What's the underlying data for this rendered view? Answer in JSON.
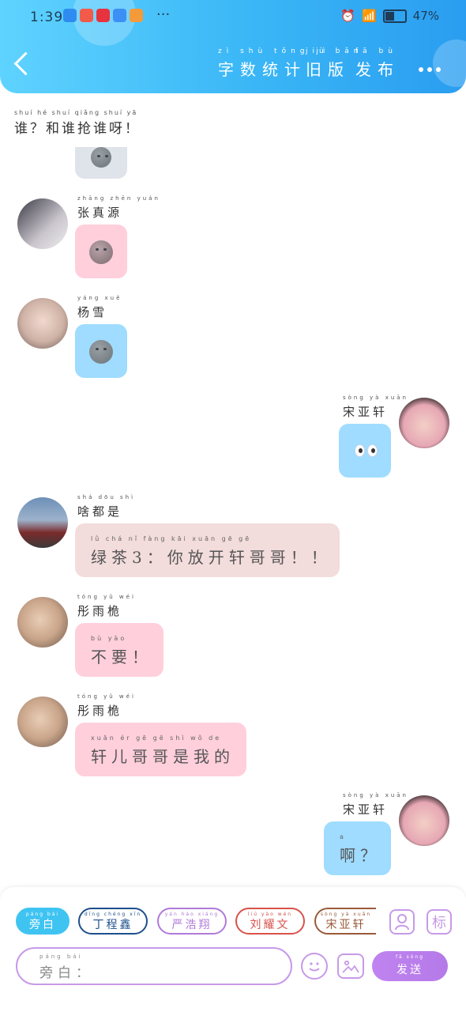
{
  "status_bar": {
    "time": "1:39",
    "more": "···",
    "battery": "47%",
    "app_icon_colors": [
      "#2e8cf0",
      "#f25a4a",
      "#e8323e",
      "#3b8ff5",
      "#f59a3a"
    ]
  },
  "header": {
    "nav": [
      {
        "label": "字数统计",
        "pinyin": "zì shù tǒng jì"
      },
      {
        "label": "旧版",
        "pinyin": "jiù bǎn"
      },
      {
        "label": "发布",
        "pinyin": "fā bù"
      }
    ],
    "gradient_colors": [
      "#5fd3ff",
      "#2a9df0"
    ]
  },
  "notice": {
    "text": "谁？和谁抢谁呀！",
    "pinyin": "shuí   hé shuí qiǎng shuí yā"
  },
  "messages": [
    {
      "side": "left",
      "name": "张真源",
      "name_pinyin": "zhāng zhēn yuán",
      "type": "emoji",
      "bubble_color": "#ffcfdc"
    },
    {
      "side": "left",
      "name": "杨雪",
      "name_pinyin": "yáng xuě",
      "type": "emoji",
      "bubble_color": "#9fdcff"
    },
    {
      "side": "right",
      "name": "宋亚轩",
      "name_pinyin": "sòng yà xuān",
      "type": "eyes",
      "bubble_color": "#9fdcff"
    },
    {
      "side": "left",
      "name": "啥都是",
      "name_pinyin": "shá dōu shì",
      "type": "text",
      "text": "绿茶3：你放开轩哥哥！！",
      "text_pinyin": "lǜ chá    nǐ fàng kāi xuān gē gē",
      "bubble_color": "#f3dcdc"
    },
    {
      "side": "left",
      "name": "彤雨桅",
      "name_pinyin": "tóng yǔ wéi",
      "type": "text",
      "text": "不要！",
      "text_pinyin": "bù yào",
      "bubble_color": "#ffcfdc"
    },
    {
      "side": "left",
      "name": "彤雨桅",
      "name_pinyin": "tóng yǔ wéi",
      "type": "text",
      "text": "轩儿哥哥是我的",
      "text_pinyin": "xuān ér gē gē shì wǒ de",
      "bubble_color": "#ffcfdc"
    },
    {
      "side": "right",
      "name": "宋亚轩",
      "name_pinyin": "sòng yà xuān",
      "type": "text",
      "text": "啊？",
      "text_pinyin": "a",
      "bubble_color": "#9fdcff"
    }
  ],
  "role_chips": [
    {
      "label": "旁白",
      "pinyin": "páng bái",
      "color": "#3fc4f2",
      "filled": true
    },
    {
      "label": "丁程鑫",
      "pinyin": "dīng chéng xīn",
      "color": "#1d4f8c",
      "filled": false
    },
    {
      "label": "严浩翔",
      "pinyin": "yán hào xiáng",
      "color": "#b07ad8",
      "filled": false
    },
    {
      "label": "刘耀文",
      "pinyin": "liú yào wén",
      "color": "#d8524a",
      "filled": false
    },
    {
      "label": "宋亚轩",
      "pinyin": "sòng yà xuān",
      "color": "#9a5a3a",
      "filled": false
    }
  ],
  "tag_button": "标",
  "input": {
    "placeholder": "旁白：",
    "placeholder_pinyin": "páng bái"
  },
  "send": {
    "label": "发送",
    "pinyin": "fā sòng",
    "color": "#be84ee"
  },
  "accent_color": "#c79ae8"
}
